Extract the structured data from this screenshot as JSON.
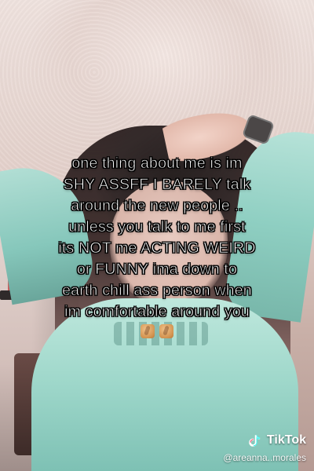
{
  "overlay": {
    "lines": [
      "one thing about me is im",
      "SHY ASSFF I BARELY talk",
      "around the new people ..",
      "unless you talk to me first",
      "its NOT me ACTING WEIRD",
      "or FUNNY ima down to",
      "earth chill ass person when",
      "im comfortable around you"
    ],
    "emoji_icons": [
      "crossed-fingers-icon",
      "crossed-fingers-icon"
    ]
  },
  "watermark": {
    "brand": "TikTok",
    "handle": "@areanna..morales"
  },
  "colors": {
    "text": "#ffffff",
    "text_outline": "#000000"
  }
}
